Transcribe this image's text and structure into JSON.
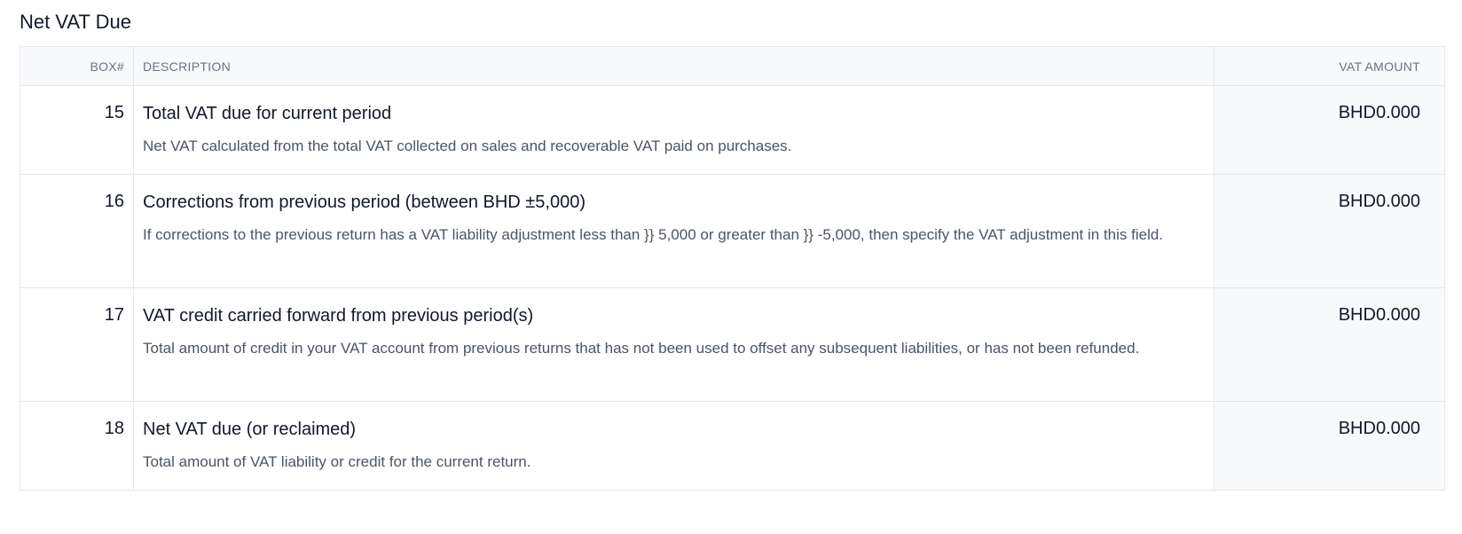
{
  "section": {
    "title": "Net VAT Due"
  },
  "table": {
    "headers": {
      "box": "BOX#",
      "description": "DESCRIPTION",
      "amount": "VAT AMOUNT"
    },
    "rows": [
      {
        "box": "15",
        "title": "Total VAT due for current period",
        "text": "Net VAT calculated from the total VAT collected on sales and recoverable VAT paid on purchases.",
        "amount": "BHD0.000"
      },
      {
        "box": "16",
        "title": "Corrections from previous period (between BHD ±5,000)",
        "text": "If corrections to the previous return has a VAT liability adjustment less than }} 5,000 or greater than }} -5,000, then specify the VAT adjustment in this field.",
        "amount": "BHD0.000"
      },
      {
        "box": "17",
        "title": "VAT credit carried forward from previous period(s)",
        "text": "Total amount of credit in your VAT account from previous returns that has not been used to offset any subsequent liabilities, or has not been refunded.",
        "amount": "BHD0.000"
      },
      {
        "box": "18",
        "title": "Net VAT due (or reclaimed)",
        "text": "Total amount of VAT liability or credit for the current return.",
        "amount": "BHD0.000"
      }
    ]
  }
}
